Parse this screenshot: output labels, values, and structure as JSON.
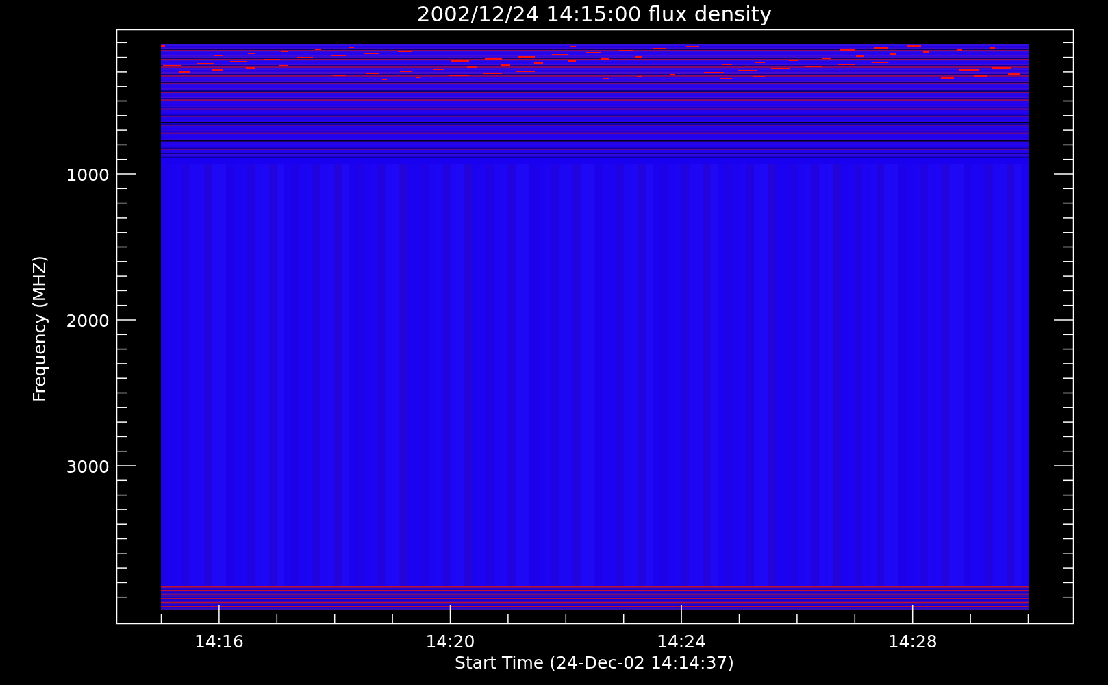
{
  "chart": {
    "title": "2002/12/24 14:15:00 flux density",
    "xlabel": "Start Time (24-Dec-02 14:14:37)",
    "ylabel": "Frequency (MHZ)",
    "xtick_labels": [
      "14:16",
      "14:20",
      "14:24",
      "14:28"
    ],
    "ytick_labels": [
      "1000",
      "2000",
      "3000"
    ]
  }
}
